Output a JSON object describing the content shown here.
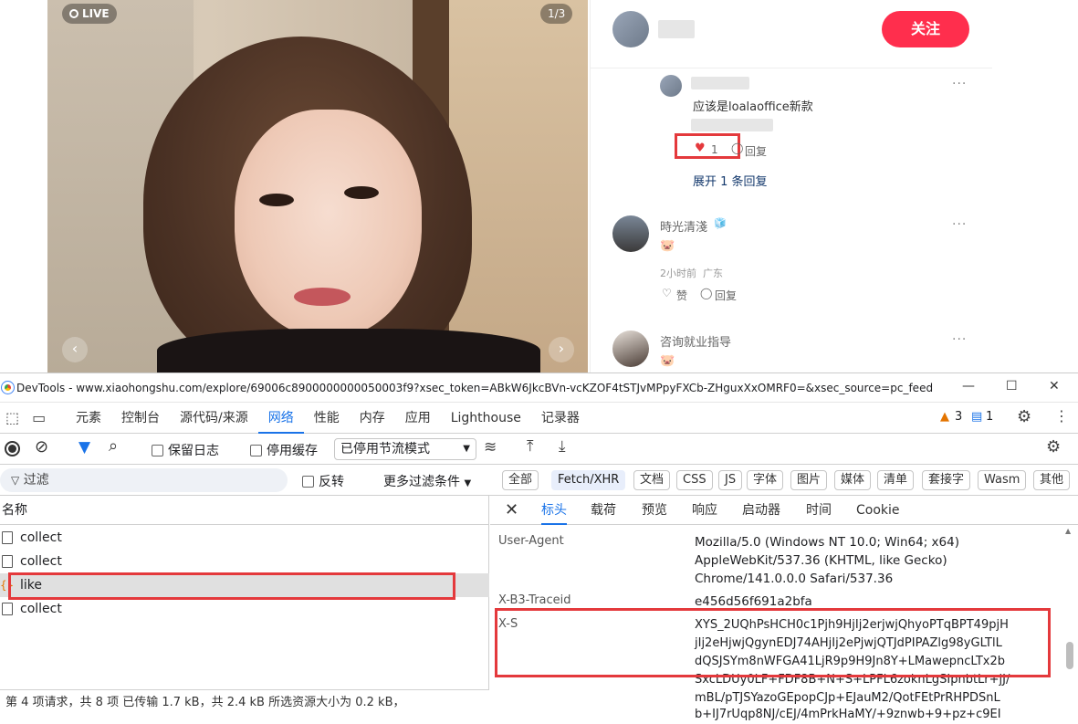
{
  "post": {
    "live_label": "LIVE",
    "pager": "1/3",
    "prev_label": "‹",
    "next_label": "›"
  },
  "panel": {
    "follow_label": "关注",
    "comments": [
      {
        "text": "应该是loalaoffice新款",
        "likes": "1",
        "reply_label": "回复",
        "expand": "展开 1 条回复",
        "more": "···"
      },
      {
        "user": "時光清淺",
        "user_badge": "🧊",
        "text": "🐷",
        "time": "2小时前",
        "location": "广东",
        "like_label": "赞",
        "reply_label": "回复",
        "more": "···"
      },
      {
        "user": "咨询就业指导",
        "text": "🐷",
        "more": "···"
      }
    ]
  },
  "devtools": {
    "title": "DevTools - www.xiaohongshu.com/explore/69006c8900000000050003f9?xsec_token=ABkW6JkcBVn-vcKZOF4tSTJvMPpyFXCb-ZHguxXxOMRF0=&xsec_source=pc_feed",
    "window_buttons": [
      "—",
      "☐",
      "✕"
    ],
    "tabs": [
      "元素",
      "控制台",
      "源代码/来源",
      "网络",
      "性能",
      "内存",
      "应用",
      "Lighthouse",
      "记录器"
    ],
    "active_tab": "网络",
    "warnings": "3",
    "messages": "1",
    "toolbar": {
      "preserve_log": "保留日志",
      "disable_cache": "停用缓存",
      "throttle": "已停用节流模式"
    },
    "filter": {
      "placeholder": "过滤",
      "invert": "反转",
      "more_filters": "更多过滤条件",
      "types": [
        "全部",
        "Fetch/XHR",
        "文档",
        "CSS",
        "JS",
        "字体",
        "图片",
        "媒体",
        "清单",
        "套接字",
        "Wasm",
        "其他"
      ],
      "selected_type": "Fetch/XHR"
    },
    "requests": {
      "column": "名称",
      "items": [
        "collect",
        "collect",
        "like",
        "collect"
      ],
      "selected": "like"
    },
    "status": "第 4 项请求，共 8 项  已传输 1.7 kB，共 2.4 kB  所选资源大小为 0.2 kB，",
    "detail_tabs": [
      "标头",
      "载荷",
      "预览",
      "响应",
      "启动器",
      "时间",
      "Cookie"
    ],
    "active_detail_tab": "标头",
    "headers": [
      {
        "name": "User-Agent",
        "value": [
          "Mozilla/5.0 (Windows NT 10.0; Win64; x64)",
          "AppleWebKit/537.36 (KHTML, like Gecko)",
          "Chrome/141.0.0.0 Safari/537.36"
        ]
      },
      {
        "name": "X-B3-Traceid",
        "value": [
          "e456d56f691a2bfa"
        ]
      },
      {
        "name": "X-S",
        "value": [
          "XYS_2UQhPsHCH0c1Pjh9HjIj2erjwjQhyoPTqBPT49pjH",
          "jIj2eHjwjQgynEDJ74AHjIj2ePjwjQTJdPIPAZlg98yGLTlL",
          "dQSJSYm8nWFGA41LjR9p9H9Jn8Y+LMawepncLTx2b",
          "SxcLDUy0LF+FDF8B+N+S+LPFL6zoknLgSIpnbtLr+jJ/",
          "mBL/pTJSYazoGEpopCJp+EJauM2/QotFEtPrRHPDSnL",
          "b+IJ7rUqp8NJ/cEJ/4mPrkHaMY/+9znwb+9+pz+c9EI"
        ]
      }
    ]
  }
}
